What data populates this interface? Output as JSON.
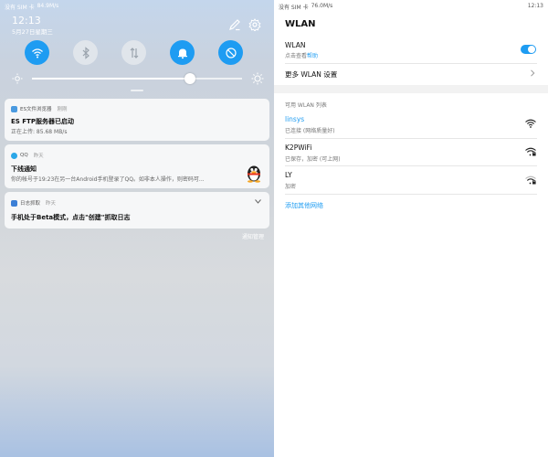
{
  "colors": {
    "accent": "#1e9cf2",
    "card_bg": "#f6f7f8"
  },
  "left": {
    "status_left": "没有 SIM 卡",
    "status_speed": "84.9M/s",
    "time": "12:13",
    "date": "5月27日星期三",
    "toggles": [
      {
        "name": "wifi-icon",
        "on": true
      },
      {
        "name": "bluetooth-icon",
        "on": false
      },
      {
        "name": "mobile-data-icon",
        "on": false
      },
      {
        "name": "bell-icon",
        "on": true
      },
      {
        "name": "auto-rotate-icon",
        "on": true
      }
    ],
    "brightness": 0.75,
    "notifications": [
      {
        "app": "ES文件浏览器",
        "time": "刚刚",
        "title": "ES FTP服务器已启动",
        "body": "正在上传: 85.68 MB/s"
      },
      {
        "app": "QQ",
        "time": "昨天",
        "title": "下线通知",
        "body": "你的帐号于19:23在另一台Android手机登录了QQ。如非本人操作，则密码可..."
      },
      {
        "app": "日志抓取",
        "time": "昨天",
        "title": "手机处于Beta模式，点击\"创建\"抓取日志",
        "body": ""
      }
    ],
    "notif_manage": "通知管理"
  },
  "right": {
    "status_left": "没有 SIM 卡",
    "status_speed": "76.0M/s",
    "time": "12:13",
    "title": "WLAN",
    "wlan_toggle": {
      "label": "WLAN",
      "sub_prefix": "点击查看",
      "sub_link": "帮助",
      "on": true
    },
    "more_settings": "更多 WLAN 设置",
    "available_label": "可用 WLAN 列表",
    "networks": [
      {
        "ssid": "linsys",
        "status": "已连接 (网络质量好)",
        "connected": true,
        "icon": "wifi-full-icon"
      },
      {
        "ssid": "K2PWiFi",
        "status": "已保存，加密 (可上网)",
        "connected": false,
        "icon": "wifi-locked-icon"
      },
      {
        "ssid": "LY",
        "status": "加密",
        "connected": false,
        "icon": "wifi-locked-weak-icon"
      }
    ],
    "add_network": "添加其他网络"
  }
}
